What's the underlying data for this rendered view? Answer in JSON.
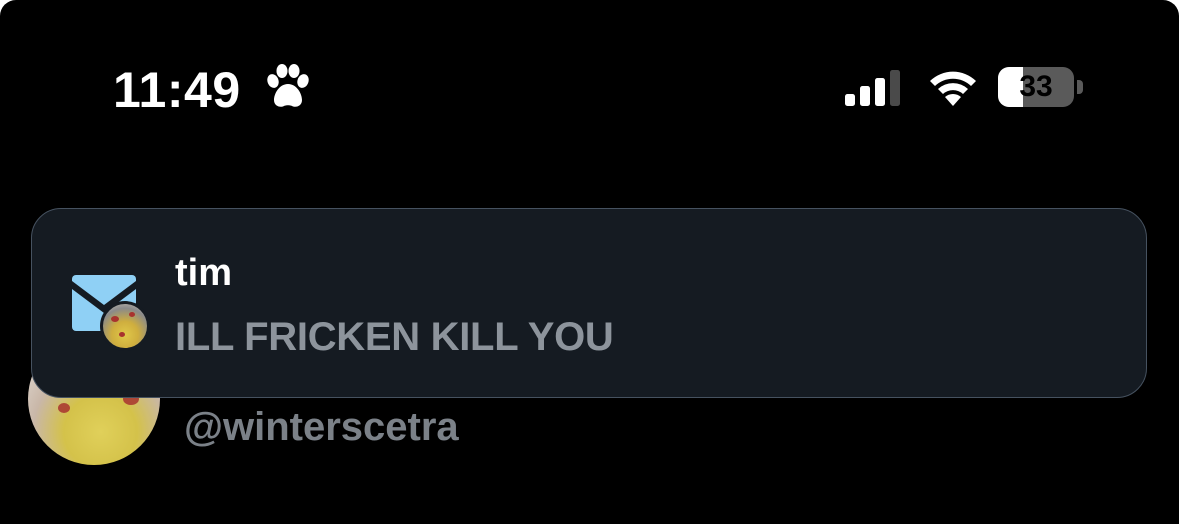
{
  "status_bar": {
    "time": "11:49",
    "focus_icon": "paw-icon",
    "signal_icon": "cellular-signal-icon",
    "signal_bars_active": 3,
    "signal_bars_total": 4,
    "wifi_icon": "wifi-icon",
    "battery_percent": "33",
    "battery_level": 0.33
  },
  "notification": {
    "app_icon": "mail-icon",
    "sender_avatar": "avatar",
    "title": "tim",
    "body": "ILL FRICKEN KILL YOU",
    "colors": {
      "background": "#151b22",
      "border": "#465260",
      "app_icon_blue": "#8fd0f5"
    }
  },
  "tweet": {
    "handle": "@winterscetra"
  }
}
